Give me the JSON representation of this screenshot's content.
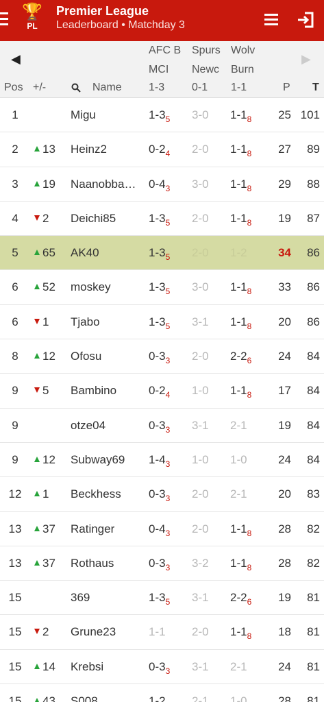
{
  "appbar": {
    "logo_text": "PL",
    "title": "Premier League",
    "subtitle": "Leaderboard • Matchday 3",
    "color": "#c8190d"
  },
  "header": {
    "prev": "◀",
    "next": "▶",
    "matches": [
      {
        "home": "AFC B",
        "away": "MCI",
        "result": "1-3"
      },
      {
        "home": "Spurs",
        "away": "Newc",
        "result": "0-1"
      },
      {
        "home": "Wolv",
        "away": "Burn",
        "result": "1-1"
      }
    ],
    "cols": {
      "pos": "Pos",
      "delta": "+/-",
      "name": "Name",
      "points": "P",
      "total": "T"
    }
  },
  "rows": [
    {
      "pos": "1",
      "dir": "",
      "delta": "",
      "name": "Migu",
      "g1": "1-3",
      "g1s": "5",
      "g1d": false,
      "g2": "3-0",
      "g2s": "",
      "g2d": true,
      "g3": "1-1",
      "g3s": "8",
      "g3d": false,
      "p": "25",
      "t": "101"
    },
    {
      "pos": "2",
      "dir": "up",
      "delta": "13",
      "name": "Heinz2",
      "g1": "0-2",
      "g1s": "4",
      "g1d": false,
      "g2": "2-0",
      "g2s": "",
      "g2d": true,
      "g3": "1-1",
      "g3s": "8",
      "g3d": false,
      "p": "27",
      "t": "89"
    },
    {
      "pos": "3",
      "dir": "up",
      "delta": "19",
      "name": "Naanobba…",
      "g1": "0-4",
      "g1s": "3",
      "g1d": false,
      "g2": "3-0",
      "g2s": "",
      "g2d": true,
      "g3": "1-1",
      "g3s": "8",
      "g3d": false,
      "p": "29",
      "t": "88"
    },
    {
      "pos": "4",
      "dir": "down",
      "delta": "2",
      "name": "Deichi85",
      "g1": "1-3",
      "g1s": "5",
      "g1d": false,
      "g2": "2-0",
      "g2s": "",
      "g2d": true,
      "g3": "1-1",
      "g3s": "8",
      "g3d": false,
      "p": "19",
      "t": "87"
    },
    {
      "pos": "5",
      "dir": "up",
      "delta": "65",
      "name": "AK40",
      "g1": "1-3",
      "g1s": "5",
      "g1d": false,
      "g2": "2-0",
      "g2s": "",
      "g2d": true,
      "g3": "1-2",
      "g3s": "",
      "g3d": true,
      "p": "34",
      "t": "86",
      "highlight": true
    },
    {
      "pos": "6",
      "dir": "up",
      "delta": "52",
      "name": "moskey",
      "g1": "1-3",
      "g1s": "5",
      "g1d": false,
      "g2": "3-0",
      "g2s": "",
      "g2d": true,
      "g3": "1-1",
      "g3s": "8",
      "g3d": false,
      "p": "33",
      "t": "86"
    },
    {
      "pos": "6",
      "dir": "down",
      "delta": "1",
      "name": "Tjabo",
      "g1": "1-3",
      "g1s": "5",
      "g1d": false,
      "g2": "3-1",
      "g2s": "",
      "g2d": true,
      "g3": "1-1",
      "g3s": "8",
      "g3d": false,
      "p": "20",
      "t": "86"
    },
    {
      "pos": "8",
      "dir": "up",
      "delta": "12",
      "name": "Ofosu",
      "g1": "0-3",
      "g1s": "3",
      "g1d": false,
      "g2": "2-0",
      "g2s": "",
      "g2d": true,
      "g3": "2-2",
      "g3s": "6",
      "g3d": false,
      "p": "24",
      "t": "84"
    },
    {
      "pos": "9",
      "dir": "down",
      "delta": "5",
      "name": "Bambino",
      "g1": "0-2",
      "g1s": "4",
      "g1d": false,
      "g2": "1-0",
      "g2s": "",
      "g2d": true,
      "g3": "1-1",
      "g3s": "8",
      "g3d": false,
      "p": "17",
      "t": "84"
    },
    {
      "pos": "9",
      "dir": "",
      "delta": "",
      "name": "otze04",
      "g1": "0-3",
      "g1s": "3",
      "g1d": false,
      "g2": "3-1",
      "g2s": "",
      "g2d": true,
      "g3": "2-1",
      "g3s": "",
      "g3d": true,
      "p": "19",
      "t": "84"
    },
    {
      "pos": "9",
      "dir": "up",
      "delta": "12",
      "name": "Subway69",
      "g1": "1-4",
      "g1s": "3",
      "g1d": false,
      "g2": "1-0",
      "g2s": "",
      "g2d": true,
      "g3": "1-0",
      "g3s": "",
      "g3d": true,
      "p": "24",
      "t": "84"
    },
    {
      "pos": "12",
      "dir": "up",
      "delta": "1",
      "name": "Beckhess",
      "g1": "0-3",
      "g1s": "3",
      "g1d": false,
      "g2": "2-0",
      "g2s": "",
      "g2d": true,
      "g3": "2-1",
      "g3s": "",
      "g3d": true,
      "p": "20",
      "t": "83"
    },
    {
      "pos": "13",
      "dir": "up",
      "delta": "37",
      "name": "Ratinger",
      "g1": "0-4",
      "g1s": "3",
      "g1d": false,
      "g2": "2-0",
      "g2s": "",
      "g2d": true,
      "g3": "1-1",
      "g3s": "8",
      "g3d": false,
      "p": "28",
      "t": "82"
    },
    {
      "pos": "13",
      "dir": "up",
      "delta": "37",
      "name": "Rothaus",
      "g1": "0-3",
      "g1s": "3",
      "g1d": false,
      "g2": "3-2",
      "g2s": "",
      "g2d": true,
      "g3": "1-1",
      "g3s": "8",
      "g3d": false,
      "p": "28",
      "t": "82"
    },
    {
      "pos": "15",
      "dir": "",
      "delta": "",
      "name": "369",
      "g1": "1-3",
      "g1s": "5",
      "g1d": false,
      "g2": "3-1",
      "g2s": "",
      "g2d": true,
      "g3": "2-2",
      "g3s": "6",
      "g3d": false,
      "p": "19",
      "t": "81"
    },
    {
      "pos": "15",
      "dir": "down",
      "delta": "2",
      "name": "Grune23",
      "g1": "1-1",
      "g1s": "",
      "g1d": true,
      "g2": "2-0",
      "g2s": "",
      "g2d": true,
      "g3": "1-1",
      "g3s": "8",
      "g3d": false,
      "p": "18",
      "t": "81"
    },
    {
      "pos": "15",
      "dir": "up",
      "delta": "14",
      "name": "Krebsi",
      "g1": "0-3",
      "g1s": "3",
      "g1d": false,
      "g2": "3-1",
      "g2s": "",
      "g2d": true,
      "g3": "2-1",
      "g3s": "",
      "g3d": true,
      "p": "24",
      "t": "81"
    },
    {
      "pos": "15",
      "dir": "up",
      "delta": "43",
      "name": "S008",
      "g1": "1-2",
      "g1s": "",
      "g1d": false,
      "g2": "2-1",
      "g2s": "",
      "g2d": true,
      "g3": "1-0",
      "g3s": "",
      "g3d": true,
      "p": "28",
      "t": "81"
    }
  ]
}
